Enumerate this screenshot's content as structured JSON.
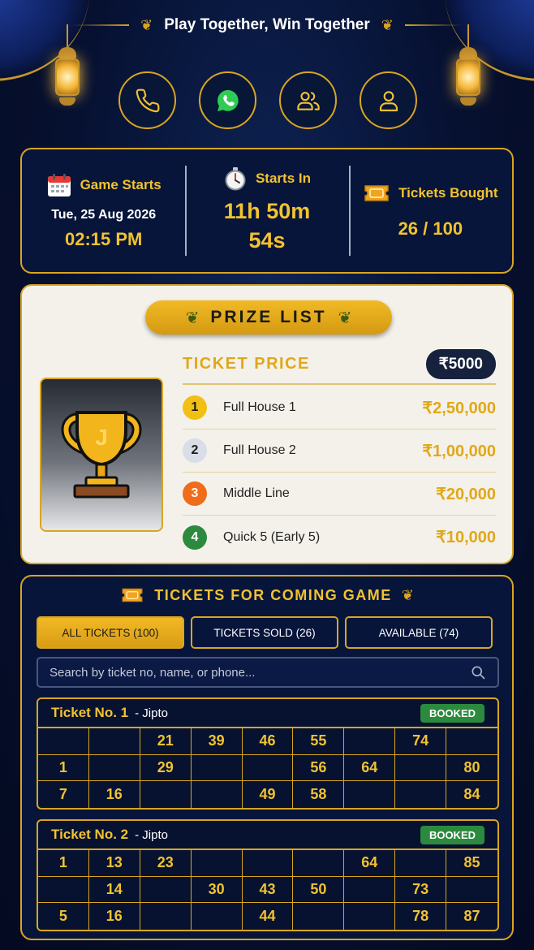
{
  "header": {
    "title": "Play Together, Win Together"
  },
  "actions": [
    {
      "name": "phone-button",
      "icon": "phone-icon"
    },
    {
      "name": "whatsapp-button",
      "icon": "whatsapp-icon"
    },
    {
      "name": "group-button",
      "icon": "users-icon"
    },
    {
      "name": "profile-button",
      "icon": "user-icon"
    }
  ],
  "info": {
    "game_starts_label": "Game Starts",
    "game_date": "Tue, 25 Aug 2026",
    "game_time": "02:15 PM",
    "starts_in_label": "Starts In",
    "countdown_line1": "11h 50m",
    "countdown_line2": "54s",
    "tickets_bought_label": "Tickets Bought",
    "tickets_bought_value": "26 / 100"
  },
  "prize": {
    "title": "PRIZE LIST",
    "ticket_price_label": "TICKET PRICE",
    "ticket_price_value": "₹5000",
    "trophy_letter": "J",
    "items": [
      {
        "rank": "1",
        "name": "Full House 1",
        "amount": "₹2,50,000",
        "color": "#f2c014",
        "text_color": "#1a1a1a"
      },
      {
        "rank": "2",
        "name": "Full House 2",
        "amount": "₹1,00,000",
        "color": "#d9dde8",
        "text_color": "#1a1a1a"
      },
      {
        "rank": "3",
        "name": "Middle Line",
        "amount": "₹20,000",
        "color": "#ef6c1a",
        "text_color": "#ffffff"
      },
      {
        "rank": "4",
        "name": "Quick 5 (Early 5)",
        "amount": "₹10,000",
        "color": "#2c8a3e",
        "text_color": "#ffffff"
      }
    ]
  },
  "tickets_section": {
    "title": "TICKETS FOR COMING GAME",
    "filters": [
      {
        "label": "ALL TICKETS (100)",
        "active": true
      },
      {
        "label": "TICKETS SOLD (26)",
        "active": false
      },
      {
        "label": "AVAILABLE (74)",
        "active": false
      }
    ],
    "search_placeholder": "Search by ticket no, name, or phone..."
  },
  "tickets": [
    {
      "label": "Ticket No. 1",
      "owner": "- Jipto",
      "status": "BOOKED",
      "rows": [
        [
          "",
          "",
          "21",
          "39",
          "46",
          "55",
          "",
          "74",
          ""
        ],
        [
          "1",
          "",
          "29",
          "",
          "",
          "56",
          "64",
          "",
          "80"
        ],
        [
          "7",
          "16",
          "",
          "",
          "49",
          "58",
          "",
          "",
          "84"
        ]
      ]
    },
    {
      "label": "Ticket No. 2",
      "owner": "- Jipto",
      "status": "BOOKED",
      "rows": [
        [
          "1",
          "13",
          "23",
          "",
          "",
          "",
          "64",
          "",
          "85"
        ],
        [
          "",
          "14",
          "",
          "30",
          "43",
          "50",
          "",
          "73",
          ""
        ],
        [
          "5",
          "16",
          "",
          "",
          "44",
          "",
          "",
          "78",
          "87"
        ]
      ]
    }
  ],
  "colors": {
    "gold": "#d9a521",
    "accent_yellow": "#f2c230",
    "navy": "#07153a",
    "booked_green": "#2c8a3e"
  }
}
